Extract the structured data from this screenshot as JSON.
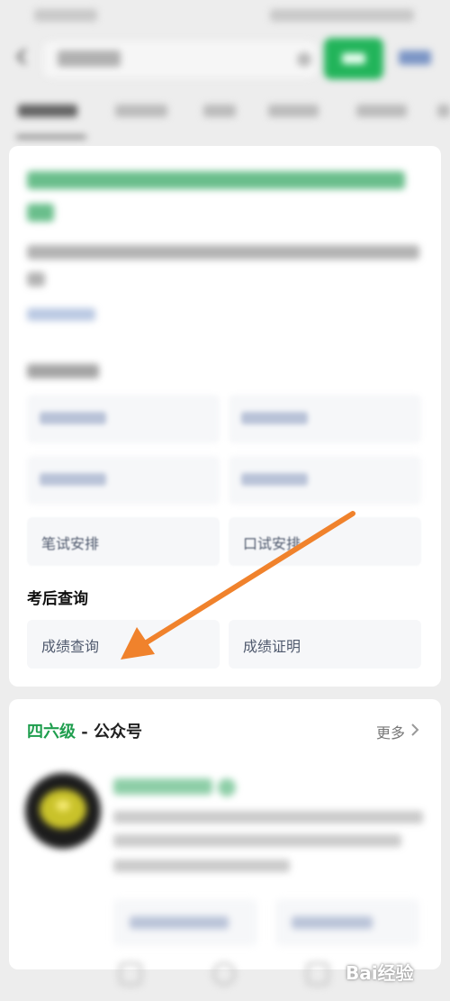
{
  "after_exam_section": {
    "title": "考后查询",
    "buttons": [
      {
        "label": "成绩查询"
      },
      {
        "label": "成绩证明"
      }
    ]
  },
  "exam_arrangements": {
    "buttons": [
      {
        "label": "笔试安排"
      },
      {
        "label": "口试安排"
      }
    ]
  },
  "official_account_card": {
    "heading_keyword": "四六级",
    "heading_suffix": " - 公众号",
    "more_label": "更多"
  },
  "watermark": {
    "text": "Bai经验"
  },
  "colors": {
    "accent_green": "#22b45a",
    "heading_green": "#1f9e4e",
    "arrow_orange": "#f0822c",
    "link_blue": "#5477b8"
  }
}
